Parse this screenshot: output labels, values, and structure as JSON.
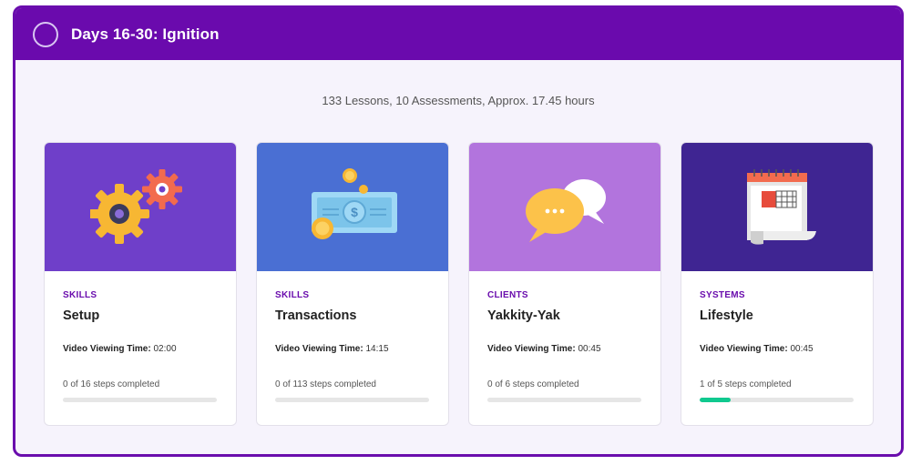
{
  "section": {
    "title": "Days 16-30: Ignition",
    "summary": "133 Lessons, 10 Assessments, Approx. 17.45 hours"
  },
  "colors": {
    "header": "#6a0aad",
    "accent": "#6a0dad",
    "progress": "#10c98f"
  },
  "cards": [
    {
      "category": "SKILLS",
      "title": "Setup",
      "video_label": "Video Viewing Time:",
      "video_time": "02:00",
      "steps": "0 of 16 steps completed",
      "progress": 0,
      "hero_color": "#6f3fc9",
      "icon": "gears-icon"
    },
    {
      "category": "SKILLS",
      "title": "Transactions",
      "video_label": "Video Viewing Time:",
      "video_time": "14:15",
      "steps": "0 of 113 steps completed",
      "progress": 0,
      "hero_color": "#4a6fd3",
      "icon": "money-icon"
    },
    {
      "category": "CLIENTS",
      "title": "Yakkity-Yak",
      "video_label": "Video Viewing Time:",
      "video_time": "00:45",
      "steps": "0 of 6 steps completed",
      "progress": 0,
      "hero_color": "#b274dd",
      "icon": "chat-bubbles-icon"
    },
    {
      "category": "SYSTEMS",
      "title": "Lifestyle",
      "video_label": "Video Viewing Time:",
      "video_time": "00:45",
      "steps": "1 of 5 steps completed",
      "progress": 0.2,
      "hero_color": "#3f2592",
      "icon": "calendar-icon"
    }
  ]
}
